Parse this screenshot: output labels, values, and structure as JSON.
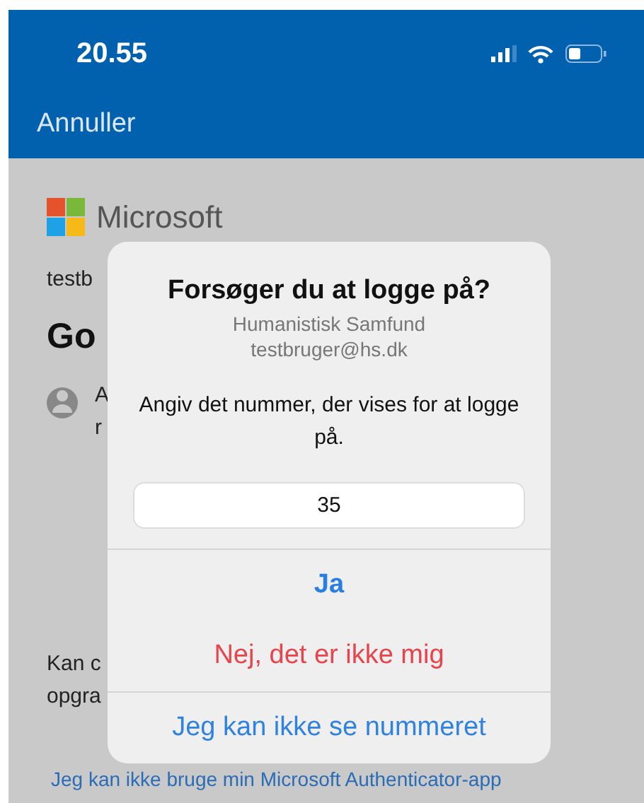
{
  "status_bar": {
    "time": "20.55"
  },
  "nav": {
    "cancel": "Annuller"
  },
  "background": {
    "brand": "Microsoft",
    "account": "testb",
    "heading": "Go",
    "row_lines": [
      "A",
      "r"
    ],
    "footer_lines": [
      "Kan c",
      "opgra"
    ],
    "link": "Jeg kan ikke bruge min Microsoft Authenticator-app"
  },
  "dialog": {
    "title": "Forsøger du at logge på?",
    "organization": "Humanistisk Samfund",
    "email": "testbruger@hs.dk",
    "instruction": "Angiv det nummer, der vises for at logge på.",
    "number_field": {
      "value": "35"
    },
    "actions": [
      {
        "label": "Ja",
        "kind": "primary",
        "divider_before": true
      },
      {
        "label": "Nej, det er ikke mig",
        "kind": "destructive",
        "divider_before": false
      },
      {
        "label": "Jeg kan ikke se nummeret",
        "kind": "default",
        "divider_before": true
      }
    ]
  }
}
